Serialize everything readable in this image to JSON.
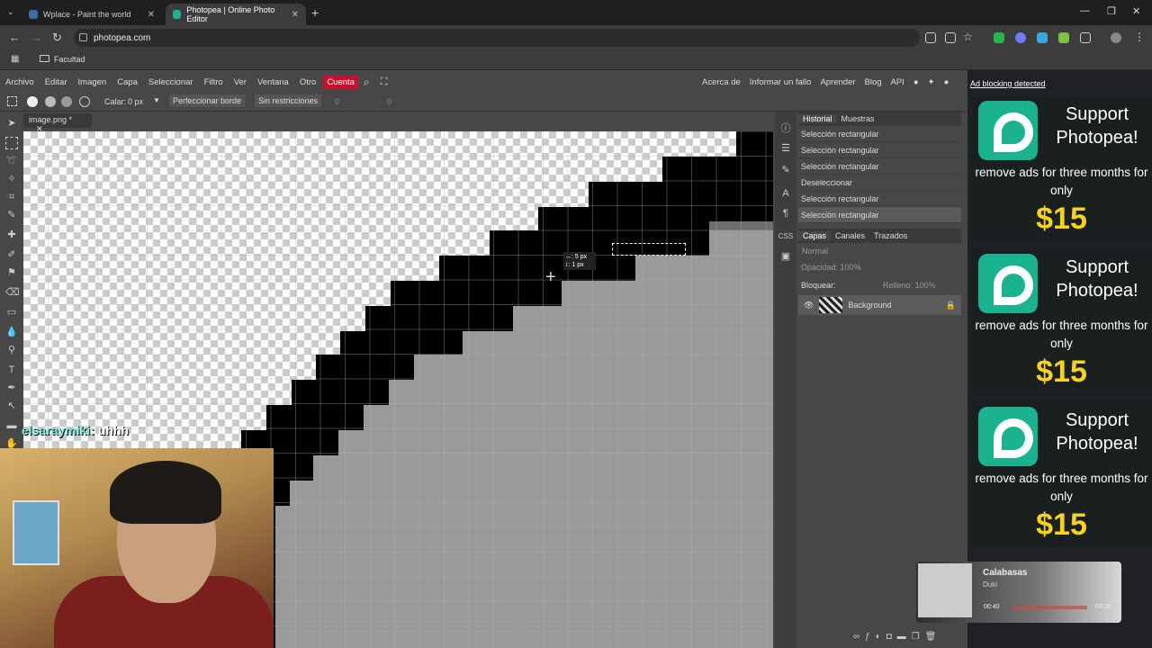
{
  "browser": {
    "tabs": [
      {
        "title": "Wplace - Paint the world",
        "active": false
      },
      {
        "title": "Photopea | Online Photo Editor",
        "active": true
      }
    ],
    "url": "photopea.com",
    "bookmark": "Facultad"
  },
  "menu": [
    "Archivo",
    "Editar",
    "Imagen",
    "Capa",
    "Seleccionar",
    "Filtro",
    "Ver",
    "Ventana",
    "Otro"
  ],
  "menu_account": "Cuenta",
  "menu_right": [
    "Acerca de",
    "Informar un fallo",
    "Aprender",
    "Blog",
    "API"
  ],
  "options": {
    "feather_label": "Calar:",
    "feather_value": "0 px",
    "refine_edge": "Perfeccionar borde",
    "style": "Sin restricciones",
    "w_value": "0",
    "h_value": "0"
  },
  "document_tab": "image.png *",
  "selection_info": {
    "w": "↔: 5 px",
    "h": "↕: 1 px"
  },
  "history": {
    "tabs": [
      "Historial",
      "Muestras"
    ],
    "items": [
      "Selección rectangular",
      "Selección rectangular",
      "Selección rectangular",
      "Deseleccionar",
      "Selección rectangular",
      "Selección rectangular"
    ]
  },
  "layers": {
    "tabs": [
      "Capas",
      "Canales",
      "Trazados"
    ],
    "blend_mode": "Normal",
    "opacity_label": "Opacidad:",
    "opacity": "100%",
    "lock_label": "Bloquear:",
    "fill_label": "Relleno:",
    "fill": "100%",
    "items": [
      "Background"
    ]
  },
  "ads": {
    "header": "Ad blocking detected",
    "support": "Support Photopea!",
    "remove": "remove ads for three months for only",
    "price": "$15"
  },
  "chat": {
    "user": "elsaraymiki:",
    "message": "uhhh"
  },
  "music": {
    "title": "Calabasas",
    "artist": "Duki",
    "elapsed": "00:40",
    "total": "03:26"
  },
  "colors": {
    "accent_red": "#c8102e",
    "brand_green": "#1bb28f",
    "price_yellow": "#f7d21e"
  }
}
